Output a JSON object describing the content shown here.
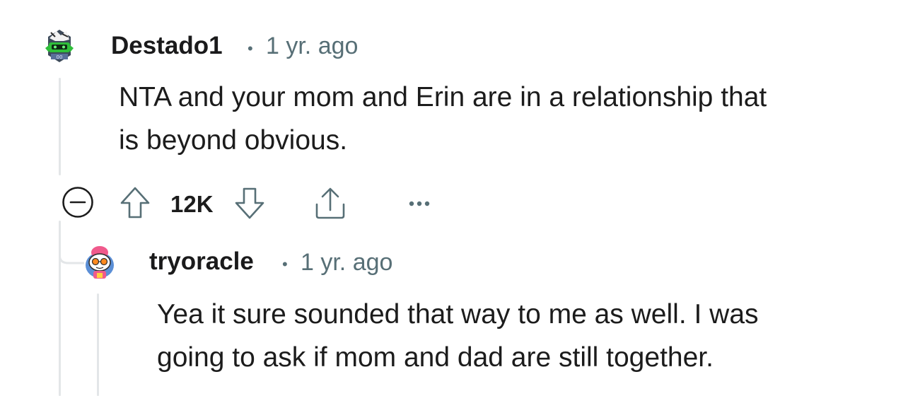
{
  "comment": {
    "author": "Destado1",
    "separator": "•",
    "time": "1 yr. ago",
    "body_line1": "NTA and your mom and Erin are in a relationship that",
    "body_line2": "is beyond obvious.",
    "score": "12K",
    "avatar_icon": "avatar-helmet-icon",
    "colors": {
      "accent": "#2fbf3a",
      "meta": "#576f76",
      "thread": "#e3e6e8"
    }
  },
  "reply": {
    "author": "tryoracle",
    "separator": "•",
    "time": "1 yr. ago",
    "body_line1": "Yea it sure sounded that way to me as well. I was",
    "body_line2": "going to ask if mom and dad are still together.",
    "avatar_icon": "avatar-snoo-icon"
  },
  "actions": {
    "collapse_icon": "collapse-minus-icon",
    "upvote_icon": "upvote-arrow-icon",
    "downvote_icon": "downvote-arrow-icon",
    "share_icon": "share-icon",
    "more_icon": "more-options-icon"
  }
}
